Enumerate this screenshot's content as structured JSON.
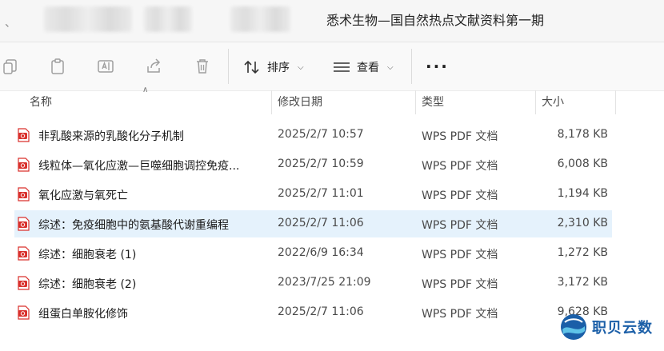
{
  "address": {
    "leading_glyph": "、",
    "current_folder": "悉术生物—国自然热点文献资料第一期"
  },
  "toolbar": {
    "sort_label": "排序",
    "view_label": "查看",
    "more_label": "···"
  },
  "columns": {
    "name": "名称",
    "modified": "修改日期",
    "type": "类型",
    "size": "大小"
  },
  "files": [
    {
      "name": "非乳酸来源的乳酸化分子机制",
      "modified": "2025/2/7 10:57",
      "type": "WPS PDF 文档",
      "size": "8,178 KB"
    },
    {
      "name": "线粒体—氧化应激—巨噬细胞调控免疫...",
      "modified": "2025/2/7 10:59",
      "type": "WPS PDF 文档",
      "size": "6,008 KB"
    },
    {
      "name": "氧化应激与氧死亡",
      "modified": "2025/2/7 11:01",
      "type": "WPS PDF 文档",
      "size": "1,194 KB"
    },
    {
      "name": "综述：免疫细胞中的氨基酸代谢重编程",
      "modified": "2025/2/7 11:06",
      "type": "WPS PDF 文档",
      "size": "2,310 KB"
    },
    {
      "name": "综述：细胞衰老 (1)",
      "modified": "2022/6/9 16:34",
      "type": "WPS PDF 文档",
      "size": "1,272 KB"
    },
    {
      "name": "综述：细胞衰老 (2)",
      "modified": "2023/7/25 21:09",
      "type": "WPS PDF 文档",
      "size": "3,172 KB"
    },
    {
      "name": "组蛋白单胺化修饰",
      "modified": "2025/2/7 11:06",
      "type": "WPS PDF 文档",
      "size": "9,628 KB"
    }
  ],
  "selected_row": 3,
  "watermark": {
    "text": "职贝云数"
  },
  "colors": {
    "selection": "#e5f2fc",
    "pdf_icon": "#d9302c",
    "watermark": "#1b5fa8"
  }
}
